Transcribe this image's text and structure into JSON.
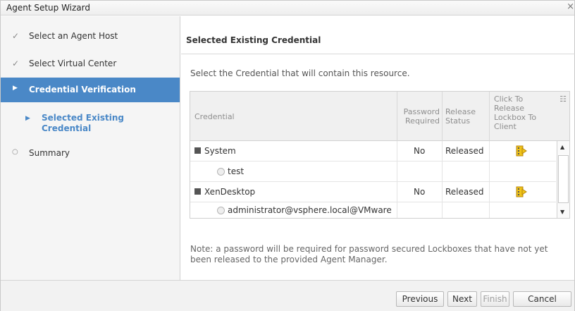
{
  "window": {
    "title": "Agent Setup Wizard"
  },
  "nav": {
    "items": [
      {
        "label": "Select an Agent Host",
        "state": "done",
        "mark": "✓"
      },
      {
        "label": "Select Virtual Center",
        "state": "done",
        "mark": "✓"
      },
      {
        "label": "Credential Verification",
        "state": "current",
        "mark": "▶"
      },
      {
        "label": "Selected Existing Credential",
        "state": "substep",
        "mark": "▶"
      },
      {
        "label": "Summary",
        "state": "pending",
        "mark": "○"
      }
    ]
  },
  "panel": {
    "title": "Selected Existing Credential",
    "prompt": "Select the Credential that will contain this resource.",
    "note": "Note: a password will be required for password secured Lockboxes that have not yet been released to the provided Agent Manager."
  },
  "grid": {
    "columns": {
      "credential": "Credential",
      "password_required": "Password Required",
      "release_status": "Release Status",
      "click_to_release": "Click To Release Lockbox To Client"
    },
    "rows": [
      {
        "type": "group",
        "credential": "System",
        "password_required": "No",
        "release_status": "Released",
        "lock_icon": "lockbox-release-icon"
      },
      {
        "type": "item",
        "credential": "test",
        "password_required": "",
        "release_status": ""
      },
      {
        "type": "group",
        "credential": "XenDesktop",
        "password_required": "No",
        "release_status": "Released",
        "lock_icon": "lockbox-release-icon"
      },
      {
        "type": "item",
        "credential": "administrator@vsphere.local@VMware",
        "password_required": "",
        "release_status": ""
      }
    ]
  },
  "footer": {
    "previous": "Previous",
    "next": "Next",
    "finish": "Finish",
    "cancel": "Cancel"
  },
  "colors": {
    "accent": "#4a88c7",
    "lock_icon": "#f0c419"
  },
  "icons": {
    "close": "×",
    "collapse": "collapse-square-icon",
    "radio": "radio-button-icon",
    "column_menu": "column-menu-icon"
  }
}
